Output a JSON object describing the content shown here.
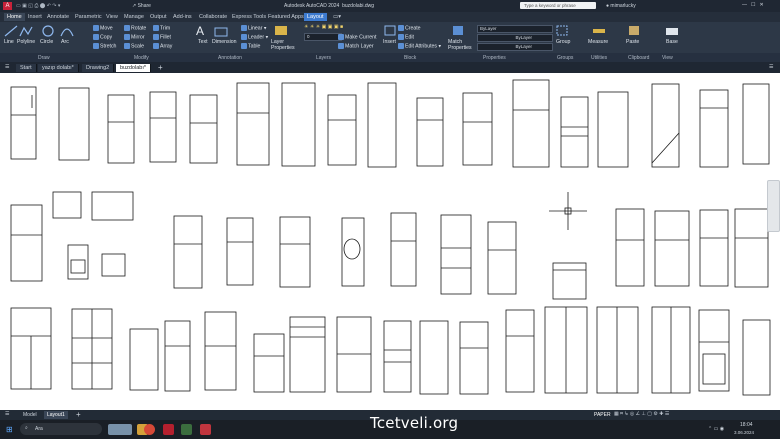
{
  "app": {
    "title": "Autodesk AutoCAD 2024",
    "file": "buzdolabi.dwg",
    "share": "Share",
    "search_placeholder": "Type a keyword or phrase",
    "user": "mimarlucky"
  },
  "ribbon_tabs": [
    "Home",
    "Insert",
    "Annotate",
    "Parametric",
    "View",
    "Manage",
    "Output",
    "Add-ins",
    "Collaborate",
    "Express Tools",
    "Featured Apps",
    "Layout"
  ],
  "draw_tools": [
    "Line",
    "Polyline",
    "Circle",
    "Arc"
  ],
  "modify_tools": [
    "Move",
    "Rotate",
    "Trim",
    "Copy",
    "Mirror",
    "Fillet",
    "Stretch",
    "Scale",
    "Array"
  ],
  "annotation_tools": [
    "Text",
    "Dimension",
    "Linear",
    "Leader",
    "Table"
  ],
  "layer_tools": [
    "Layer Properties",
    "Make Current",
    "Match Layer"
  ],
  "block_tools": [
    "Insert",
    "Create",
    "Edit",
    "Edit Attributes"
  ],
  "properties": {
    "match": "Match Properties",
    "bylayer": "ByLayer",
    "layer_value": "0"
  },
  "other_groups": [
    "Group",
    "Measure",
    "Paste",
    "Base"
  ],
  "panel_labels": [
    "Draw",
    "Modify",
    "Annotation",
    "Layers",
    "Block",
    "Properties",
    "Groups",
    "Utilities",
    "Clipboard",
    "View"
  ],
  "doc_tabs": [
    "Start",
    "yazıp dolabı*",
    "Drawing2",
    "buzdolabı*"
  ],
  "layout_tabs": [
    "Model",
    "Layout1"
  ],
  "status": {
    "paper": "PAPER"
  },
  "taskbar": {
    "search": "Ara",
    "time": "18:04",
    "date": "3.06.2024"
  },
  "watermark": "Tcetveli.org",
  "colors": {
    "accent": "#3d7bd0",
    "ribbon": "#2d3847",
    "titlebar": "#1f2733"
  }
}
